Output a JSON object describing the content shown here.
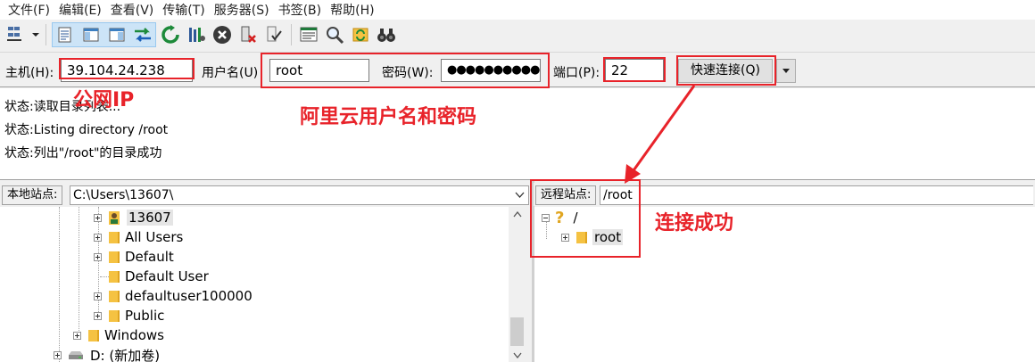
{
  "menu": [
    "文件(F)",
    "编辑(E)",
    "查看(V)",
    "传输(T)",
    "服务器(S)",
    "书签(B)",
    "帮助(H)"
  ],
  "quickconnect": {
    "host_label": "主机(H):",
    "host_value": "39.104.24.238",
    "user_label": "用户名(U)",
    "user_value": "root",
    "pass_label": "密码(W):",
    "pass_value": "●●●●●●●●●●",
    "port_label": "端口(P):",
    "port_value": "22",
    "connect_label": "快速连接(Q)"
  },
  "annotations": {
    "public_ip": "公网IP",
    "aliyun_user_pass": "阿里云用户名和密码",
    "connected": "连接成功",
    "color": "#e8232a"
  },
  "log": [
    "状态:读取目录列表...",
    "状态:Listing directory /root",
    "状态:列出\"/root\"的目录成功"
  ],
  "local": {
    "label": "本地站点:",
    "path": "C:\\Users\\13607\\",
    "tree": [
      {
        "name": "13607",
        "icon": "user-folder-icon",
        "expander": "plus"
      },
      {
        "name": "All Users",
        "icon": "folder-icon",
        "expander": "plus"
      },
      {
        "name": "Default",
        "icon": "folder-icon",
        "expander": "plus"
      },
      {
        "name": "Default User",
        "icon": "folder-icon",
        "expander": "none"
      },
      {
        "name": "defaultuser100000",
        "icon": "folder-icon",
        "expander": "plus"
      },
      {
        "name": "Public",
        "icon": "folder-icon",
        "expander": "plus"
      },
      {
        "name": "Windows",
        "icon": "folder-icon",
        "expander": "plus"
      },
      {
        "name": "D: (新加卷)",
        "icon": "drive-icon",
        "expander": "plus"
      }
    ]
  },
  "remote": {
    "label": "远程站点:",
    "path": "/root",
    "tree": [
      {
        "name": "/",
        "icon": "question-icon",
        "expander": "minus"
      },
      {
        "name": "root",
        "icon": "folder-icon",
        "expander": "plus"
      }
    ]
  }
}
